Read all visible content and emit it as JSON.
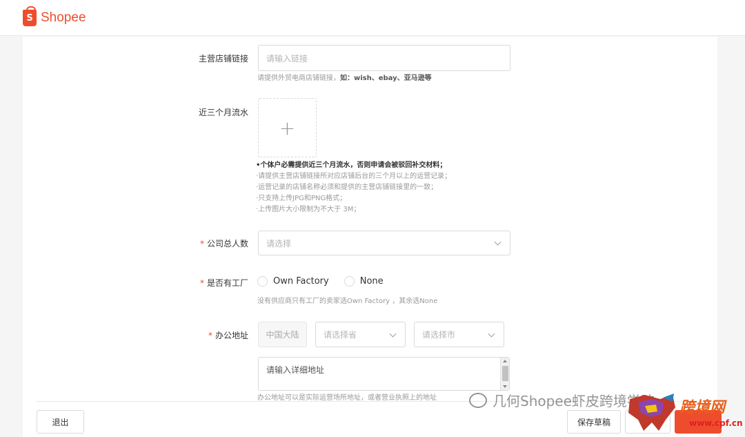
{
  "app": {
    "brand": "Shopee"
  },
  "form": {
    "store_link": {
      "label": "主营店铺链接",
      "placeholder": "请输入链接",
      "hint_prefix": "请提供外贸电商店铺链接，",
      "hint_bold": "如：wish、ebay、亚马逊等"
    },
    "turnover": {
      "label": "近三个月流水",
      "upload_icon": "plus-icon",
      "rules": [
        "•个体户必需提供近三个月流水，否则申请会被驳回补交材料；",
        "·请提供主营店铺链接所对应店铺后台的三个月以上的运营记录；",
        "·运营记录的店铺名称必须和提供的主营店铺链接里的一致；",
        "·只支持上传JPG和PNG格式；",
        "·上传图片大小限制为不大于 3M；"
      ]
    },
    "employees": {
      "required_mark": "*",
      "label": "公司总人数",
      "placeholder": "请选择"
    },
    "factory": {
      "required_mark": "*",
      "label": "是否有工厂",
      "options": [
        "Own Factory",
        "None"
      ],
      "hint": "没有供应商只有工厂的卖家选Own Factory ，其余选None"
    },
    "address": {
      "required_mark": "*",
      "label": "办公地址",
      "country": "中国大陆",
      "province_placeholder": "请选择省",
      "city_placeholder": "请选择市",
      "detail_placeholder": "请输入详细地址",
      "hint": "办公地址可以是实际运营场所地址，或者营业执照上的地址"
    }
  },
  "footer": {
    "exit_label": "退出",
    "save_draft_label": "保存草稿"
  },
  "watermark": {
    "text": "几何Shopee虾皮跨境学院",
    "site_name": "跨境网",
    "site_url": "www.cpf.cn"
  },
  "colors": {
    "accent": "#ee4d2d",
    "required": "#ee4d2d"
  }
}
